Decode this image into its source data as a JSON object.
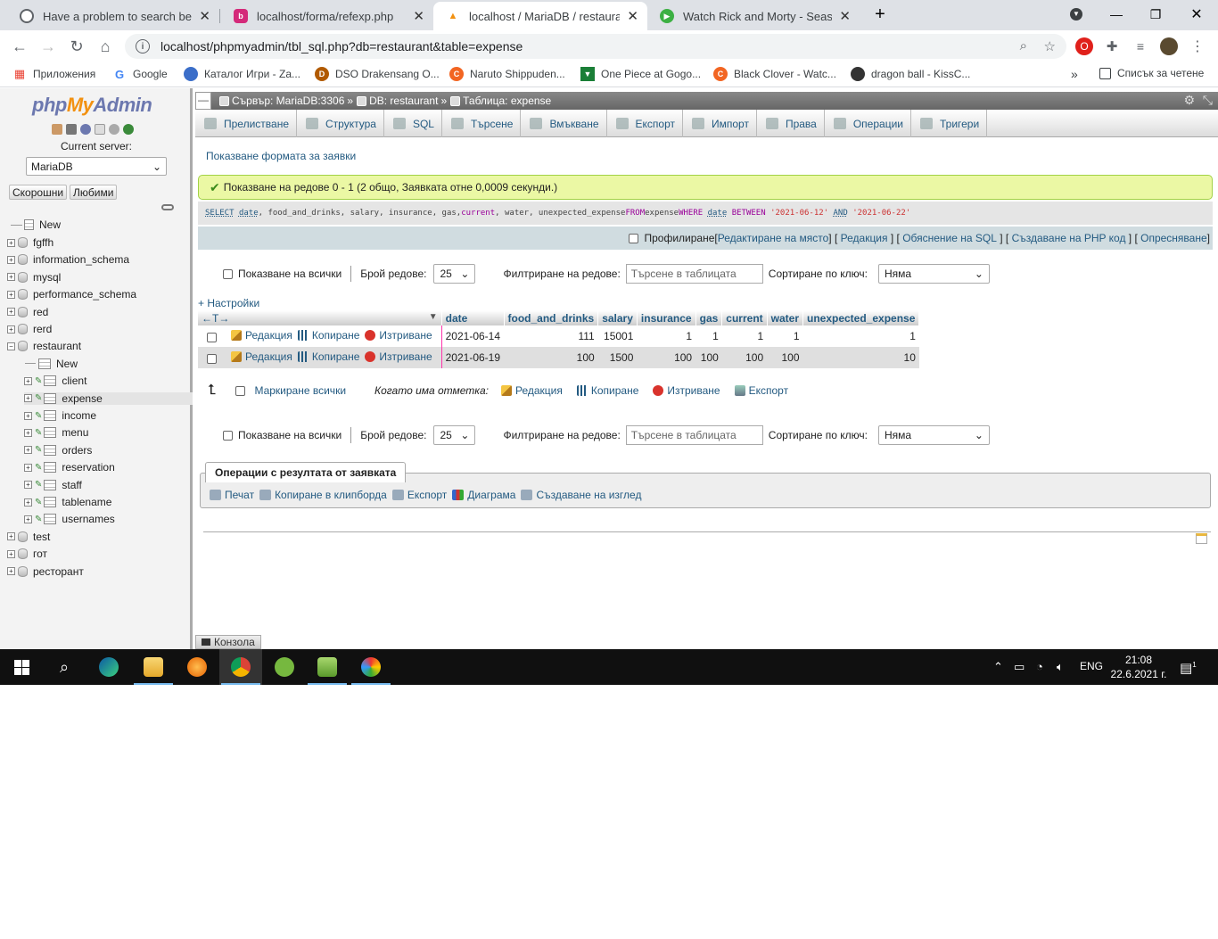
{
  "browser": {
    "tabs": [
      {
        "title": "Have a problem to search betwe",
        "favicon_color": "#5f6368"
      },
      {
        "title": "localhost/forma/refexp.php",
        "favicon_color": "#d42a7a"
      },
      {
        "title": "localhost / MariaDB / restaurant",
        "favicon_color": "#f29111"
      },
      {
        "title": "Watch Rick and Morty - Season 3",
        "favicon_color": "#3cb043"
      }
    ],
    "new_tab": "+",
    "url": "localhost/phpmyadmin/tbl_sql.php?db=restaurant&table=expense",
    "bookmarks": [
      {
        "label": "Приложения",
        "color": "#4285f4"
      },
      {
        "label": "Google",
        "color": "#ea4335"
      },
      {
        "label": "Каталог Игри - Za...",
        "color": "#3b6ec9"
      },
      {
        "label": "DSO Drakensang O...",
        "color": "#b15a00"
      },
      {
        "label": "Naruto Shippuden...",
        "color": "#f26522"
      },
      {
        "label": "One Piece at Gogo...",
        "color": "#1a7f37"
      },
      {
        "label": "Black Clover - Watc...",
        "color": "#f26522"
      },
      {
        "label": "dragon ball - KissC...",
        "color": "#333333"
      }
    ],
    "bookmarks_more": "»",
    "reading_list": "Списък за четене"
  },
  "pma": {
    "logo": {
      "php": "php",
      "my": "My",
      "admin": "Admin"
    },
    "current_server_label": "Current server:",
    "server_value": "MariaDB",
    "recent_btn": "Скорошни",
    "favorites_btn": "Любими",
    "tree": {
      "new": "New",
      "dbs_top": [
        "fgffh",
        "information_schema",
        "mysql",
        "performance_schema",
        "red",
        "rerd",
        "restaurant"
      ],
      "tables": [
        "New",
        "client",
        "expense",
        "income",
        "menu",
        "orders",
        "reservation",
        "staff",
        "tablename",
        "usernames"
      ],
      "dbs_bottom": [
        "test",
        "гот",
        "ресторант"
      ]
    },
    "breadcrumb": {
      "server": "Сървър: MariaDB:3306",
      "db": "DB: restaurant",
      "table": "Таблица: expense",
      "sep": "»"
    },
    "menu": [
      "Прелистване",
      "Структура",
      "SQL",
      "Търсене",
      "Вмъкване",
      "Експорт",
      "Импорт",
      "Права",
      "Операции",
      "Тригери"
    ],
    "show_query_form": "Показване формата за заявки",
    "success_msg": "Показване на редове 0 - 1 (2 общо, Заявката отне 0,0009 секунди.)",
    "sql": {
      "select": "SELECT",
      "date": "date",
      "cols": ", food_and_drinks, salary, insurance, gas, ",
      "current": "current",
      "rest": ", water, unexpected_expense ",
      "from": "FROM",
      "tbl": " expense ",
      "where": "WHERE",
      "date2": "date",
      "between": "BETWEEN",
      "d1": "'2021-06-12'",
      "and": "AND",
      "d2": "'2021-06-22'"
    },
    "sql_actions": {
      "profiling": "Профилиране",
      "inline": "Редактиране на място",
      "edit": "Редакция",
      "explain": "Обяснение на SQL",
      "php": "Създаване на PHP код",
      "refresh": "Опресняване"
    },
    "nav": {
      "show_all": "Показване на всички",
      "rows_label": "Брой редове:",
      "rows_value": "25",
      "filter_label": "Филтриране на редове:",
      "filter_placeholder": "Търсене в таблицата",
      "sort_label": "Сортиране по ключ:",
      "sort_value": "Няма"
    },
    "settings": "+ Настройки",
    "table": {
      "arrows": "←T→",
      "columns": [
        "date",
        "food_and_drinks",
        "salary",
        "insurance",
        "gas",
        "current",
        "water",
        "unexpected_expense"
      ],
      "rows": [
        [
          "2021-06-14",
          "111",
          "15001",
          "1",
          "1",
          "1",
          "1",
          "1"
        ],
        [
          "2021-06-19",
          "100",
          "1500",
          "100",
          "100",
          "100",
          "100",
          "10"
        ]
      ],
      "edit": "Редакция",
      "copy": "Копиране",
      "delete": "Изтриване"
    },
    "bulk": {
      "mark_all": "Маркиране всички",
      "with_selected": "Когато има отметка:",
      "edit": "Редакция",
      "copy": "Копиране",
      "delete": "Изтриване",
      "export": "Експорт"
    },
    "ops": {
      "legend": "Операции с резултата от заявката",
      "print": "Печат",
      "clipboard": "Копиране в клипборда",
      "export": "Експорт",
      "chart": "Диаграма",
      "view": "Създаване на изглед"
    },
    "console": "Конзола"
  },
  "taskbar": {
    "lang": "ENG",
    "time": "21:08",
    "date": "22.6.2021 г.",
    "notif": "1"
  }
}
